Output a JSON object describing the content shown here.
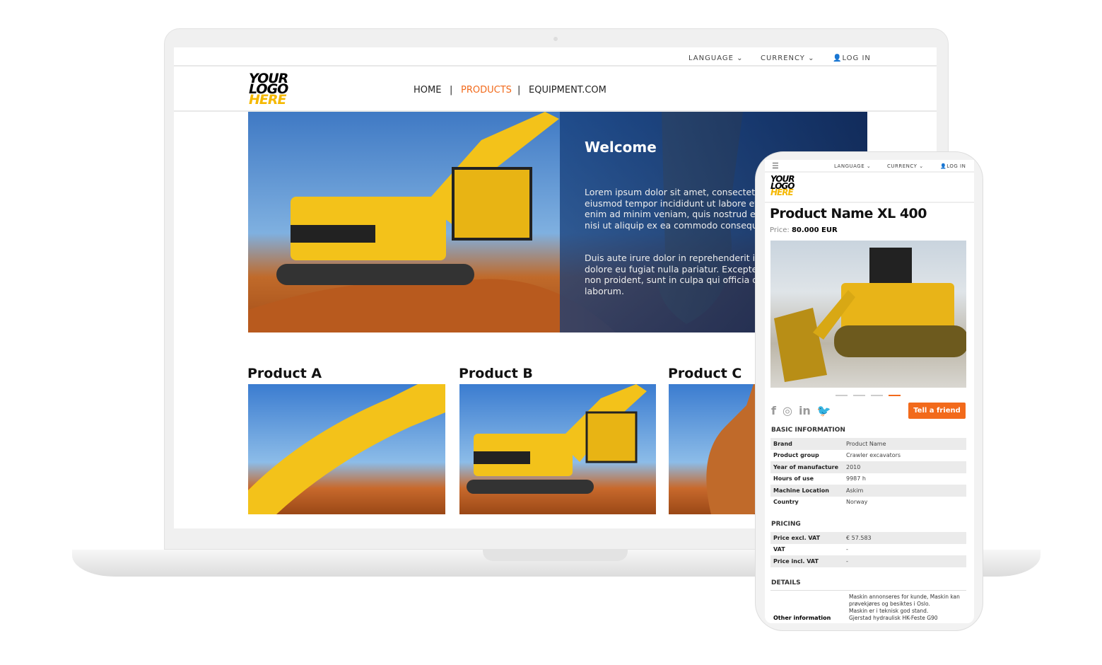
{
  "desktop": {
    "topbar": {
      "language": "LANGUAGE",
      "currency": "CURRENCY",
      "login": "LOG IN"
    },
    "logo": [
      "YOUR",
      "LOGO",
      "HERE"
    ],
    "nav": [
      {
        "label": "HOME"
      },
      {
        "label": "|"
      },
      {
        "label": "PRODUCTS",
        "active": true
      },
      {
        "label": "|"
      },
      {
        "label": "EQUIPMENT.COM"
      }
    ],
    "hero": {
      "title": "Welcome",
      "p1": "Lorem ipsum dolor sit amet, consectetur adipiscing elit, sed do eiusmod tempor incididunt ut labore et dolore magna aliqua. Ut enim ad minim veniam, quis nostrud exercitation ullamco laboris nisi ut aliquip ex ea commodo consequat.",
      "p2": "Duis aute irure dolor in reprehenderit in voluptate velit esse cillum dolore eu fugiat nulla pariatur. Excepteur sint occaecat cupidatat non proident, sunt in culpa qui officia deserunt mollit anim id est laborum."
    },
    "products": [
      {
        "title": "Product A"
      },
      {
        "title": "Product B"
      },
      {
        "title": "Product C"
      }
    ]
  },
  "mobile": {
    "topbar": {
      "language": "LANGUAGE",
      "currency": "CURRENCY",
      "login": "LOG IN"
    },
    "logo": [
      "YOUR",
      "LOGO",
      "HERE"
    ],
    "title": "Product Name XL 400",
    "price_label": "Price:",
    "price_value": "80.000 EUR",
    "carousel": {
      "slides": 4,
      "active": 4
    },
    "social": [
      "facebook-icon",
      "instagram-icon",
      "linkedin-icon",
      "twitter-icon"
    ],
    "tell_friend": "Tell a friend",
    "basic": {
      "heading": "BASIC INFORMATION",
      "rows": [
        [
          "Brand",
          "Product Name"
        ],
        [
          "Product group",
          "Crawler excavators"
        ],
        [
          "Year of manufacture",
          "2010"
        ],
        [
          "Hours of use",
          "9987 h"
        ],
        [
          "Machine Location",
          "Askim"
        ],
        [
          "Country",
          "Norway"
        ]
      ]
    },
    "pricing": {
      "heading": "PRICING",
      "rows": [
        [
          "Price excl. VAT",
          "€ 57.583"
        ],
        [
          "VAT",
          "-"
        ],
        [
          "Price incl. VAT",
          "-"
        ]
      ]
    },
    "details": {
      "heading": "DETAILS",
      "label": "Other information",
      "lines": [
        "Maskin annonseres for kunde, Maskin kan",
        "prøvekjøres og besiktes i Oslo.",
        "Maskin er i teknisk god stand.",
        "Gjerstad hydraulisk HK-Feste G90"
      ]
    }
  },
  "colors": {
    "accent": "#f26a1b",
    "logo_yellow": "#f5b800"
  }
}
